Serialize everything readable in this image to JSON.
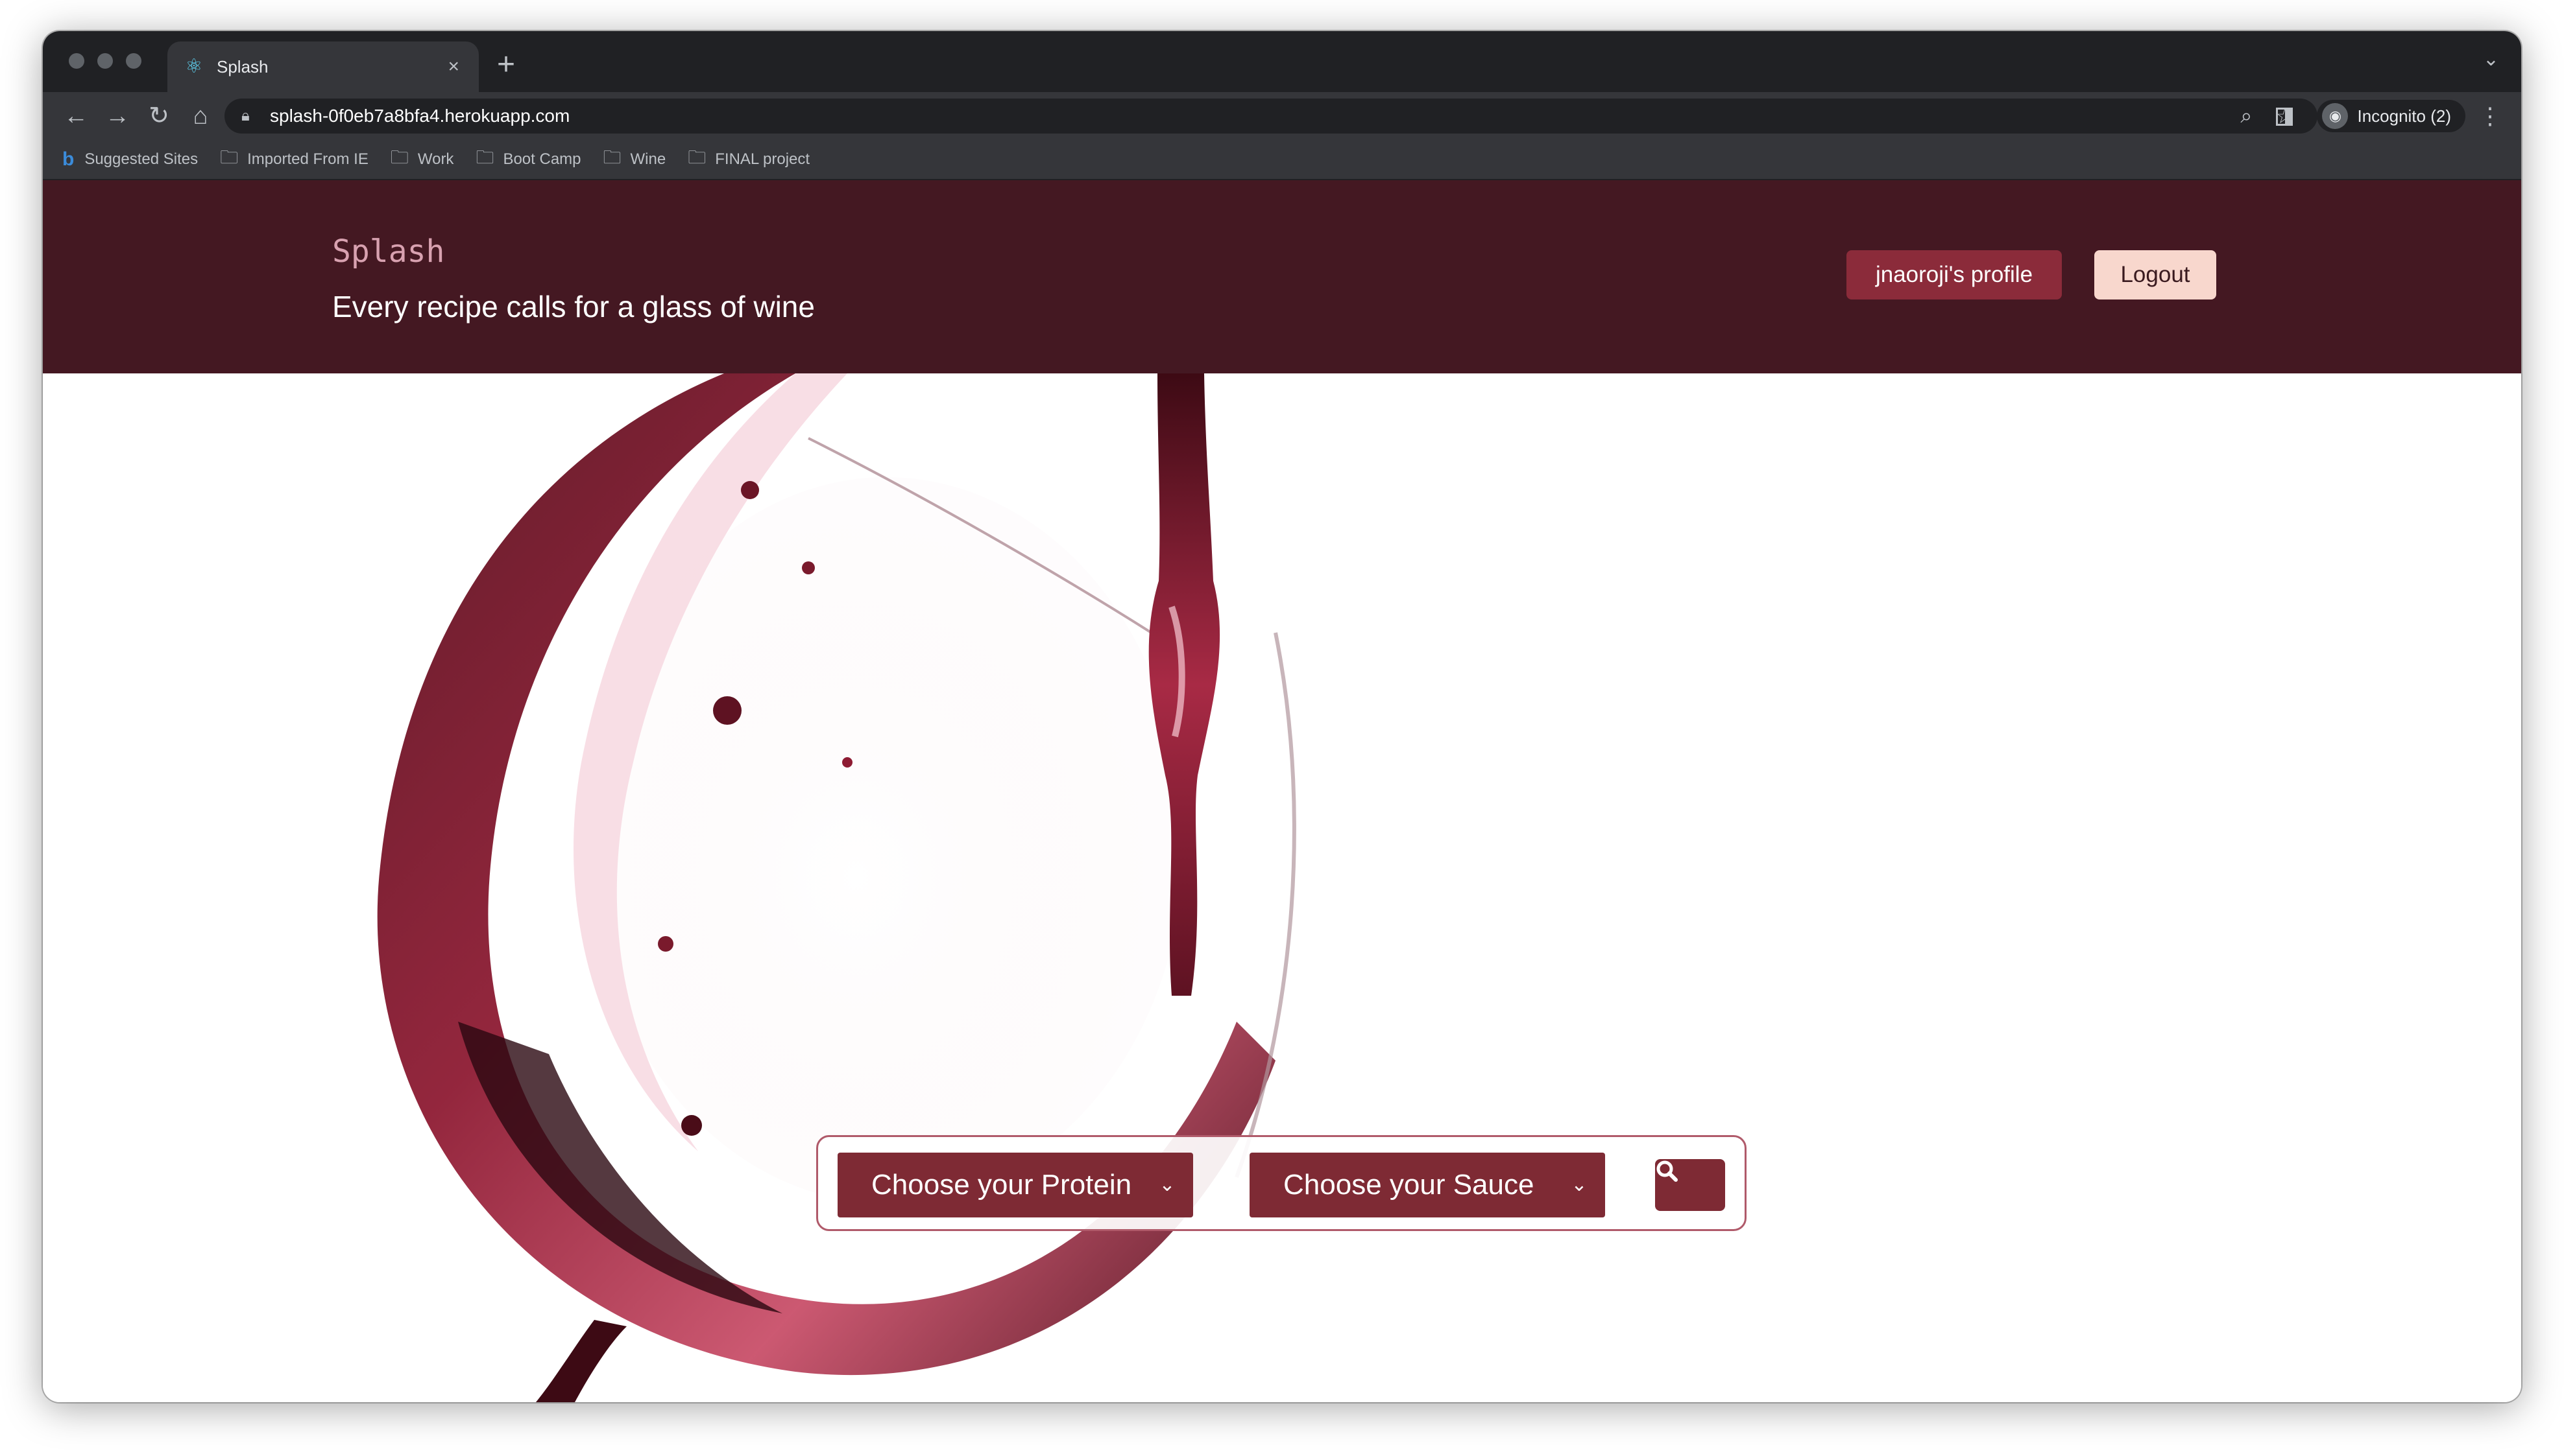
{
  "browser": {
    "tab_title": "Splash",
    "tab_close": "×",
    "new_tab": "+",
    "url": "splash-0f0eb7a8bfa4.herokuapp.com",
    "profile_label": "Incognito (2)",
    "bookmarks": [
      {
        "label": "Suggested Sites",
        "icon": "bing-icon"
      },
      {
        "label": "Imported From IE",
        "icon": "folder-icon"
      },
      {
        "label": "Work",
        "icon": "folder-icon"
      },
      {
        "label": "Boot Camp",
        "icon": "folder-icon"
      },
      {
        "label": "Wine",
        "icon": "folder-icon"
      },
      {
        "label": "FINAL project",
        "icon": "folder-icon"
      }
    ]
  },
  "header": {
    "brand": "Splash",
    "tagline": "Every recipe calls for a glass of wine",
    "profile_button": "jnaoroji's profile",
    "logout_button": "Logout"
  },
  "search": {
    "protein_select": "Choose your Protein",
    "sauce_select": "Choose your Sauce",
    "search_icon": "search-icon"
  },
  "colors": {
    "header_bg": "#441822",
    "accent": "#7e2a34",
    "profile_button": "#8b2b3a",
    "logout_button": "#f8d7cd",
    "brand_text": "#d8a1b0"
  }
}
